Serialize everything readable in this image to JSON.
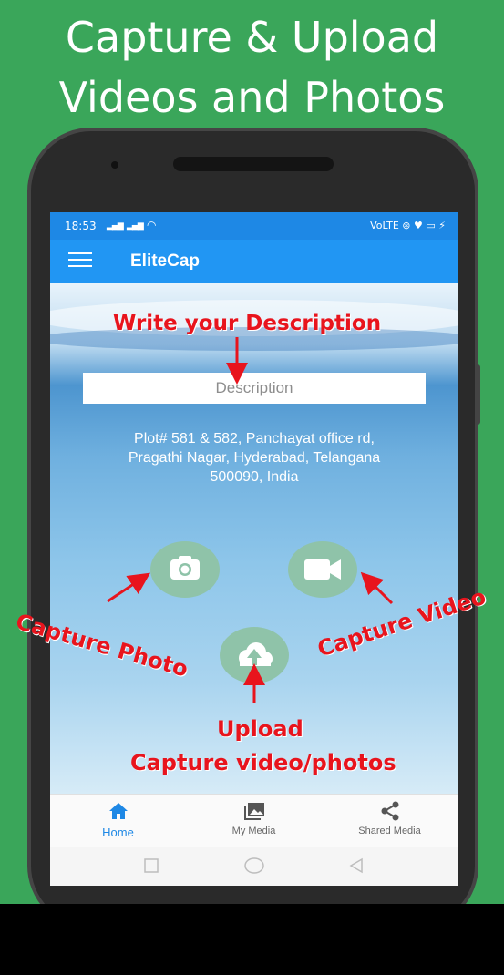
{
  "headline": {
    "line1": "Capture & Upload",
    "line2": "Videos and Photos"
  },
  "status_bar": {
    "time": "18:53",
    "right": "VoLTE ⊛ ♥ ▭ ⚡"
  },
  "app_bar": {
    "title": "EliteCap",
    "menu_icon": "hamburger-menu-icon"
  },
  "description": {
    "placeholder": "Description"
  },
  "address": {
    "line1": "Plot# 581 & 582, Panchayat office rd,",
    "line2": "Pragathi Nagar, Hyderabad, Telangana",
    "line3": "500090, India"
  },
  "actions": {
    "photo_icon": "camera-icon",
    "video_icon": "video-camera-icon",
    "upload_icon": "cloud-upload-icon"
  },
  "bottom_nav": {
    "items": [
      {
        "label": "Home",
        "icon": "home-icon",
        "active": true
      },
      {
        "label": "My Media",
        "icon": "gallery-icon",
        "active": false
      },
      {
        "label": "Shared Media",
        "icon": "share-icon",
        "active": false
      }
    ]
  },
  "annotations": {
    "write_description": "Write your Description",
    "capture_photo": "Capture Photo",
    "capture_video": "Capture Video",
    "upload": "Upload",
    "upload_sub": "Capture video/photos"
  },
  "colors": {
    "background": "#3aa65a",
    "app_bar": "#2196f3",
    "annotation": "#e8141d",
    "action_button": "#8fc3a9",
    "nav_active": "#1e88e5"
  }
}
